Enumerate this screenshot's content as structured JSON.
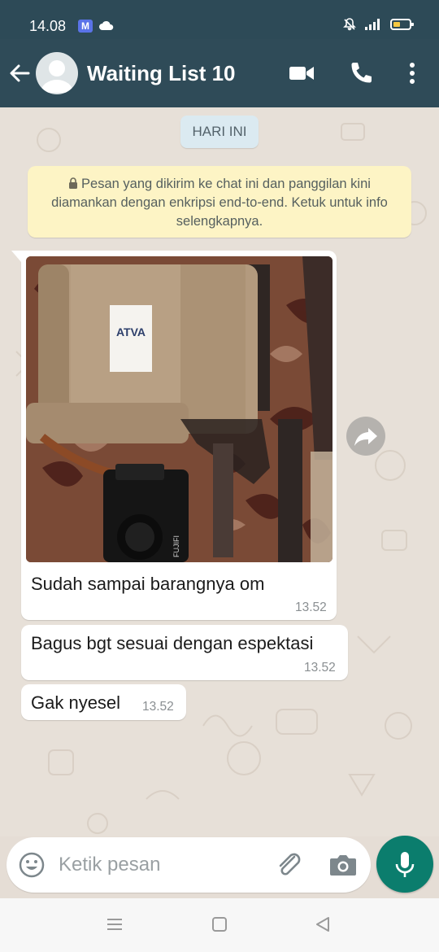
{
  "status_bar": {
    "time": "14.08",
    "app_badge": "M"
  },
  "header": {
    "title": "Waiting List 10"
  },
  "chat": {
    "date_chip": "HARI INI",
    "encryption_notice": "Pesan yang dikirim ke chat ini dan panggilan kini diamankan dengan enkripsi end-to-end. Ketuk untuk info selengkapnya.",
    "messages": [
      {
        "type": "image",
        "photo_label": "ATVA",
        "camera_brand": "FUJIFI",
        "text": "Sudah sampai barangnya om",
        "time": "13.52"
      },
      {
        "type": "text",
        "text": "Bagus bgt sesuai dengan espektasi",
        "time": "13.52"
      },
      {
        "type": "text",
        "text": "Gak nyesel",
        "time": "13.52"
      }
    ]
  },
  "composer": {
    "placeholder": "Ketik pesan"
  },
  "colors": {
    "header_bg": "#2f4b58",
    "chat_bg": "#e7e0d8",
    "notice_bg": "#fdf4c5",
    "mic_button": "#0b7d6d"
  },
  "icons": [
    "back-arrow-icon",
    "avatar-placeholder-icon",
    "video-call-icon",
    "phone-icon",
    "more-vert-icon",
    "lock-icon",
    "forward-icon",
    "emoji-icon",
    "attach-icon",
    "camera-icon",
    "mic-icon",
    "nav-menu-icon",
    "nav-home-icon",
    "nav-back-icon"
  ]
}
